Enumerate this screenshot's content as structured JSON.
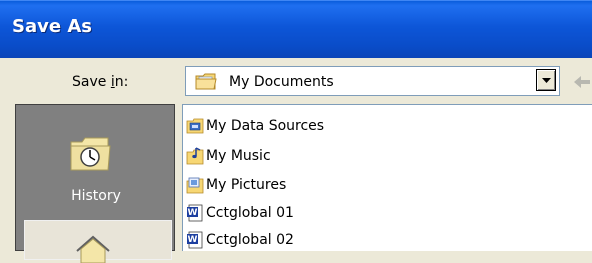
{
  "window": {
    "title": "Save As"
  },
  "save_in": {
    "label_prefix": "Save ",
    "label_accel": "i",
    "label_suffix": "n:",
    "selected": "My Documents"
  },
  "places": [
    {
      "label": "History",
      "icon": "history-folder-icon"
    }
  ],
  "files": [
    {
      "name": "My Data Sources",
      "icon": "data-sources-folder-icon"
    },
    {
      "name": "My Music",
      "icon": "music-folder-icon"
    },
    {
      "name": "My Pictures",
      "icon": "pictures-folder-icon"
    },
    {
      "name": "Cctglobal 01",
      "icon": "word-document-icon"
    },
    {
      "name": "Cctglobal 02",
      "icon": "word-document-icon"
    }
  ],
  "colors": {
    "titlebar": "#0a4cc8",
    "dialog_bg": "#ece9d8",
    "places_bar": "#808080"
  }
}
